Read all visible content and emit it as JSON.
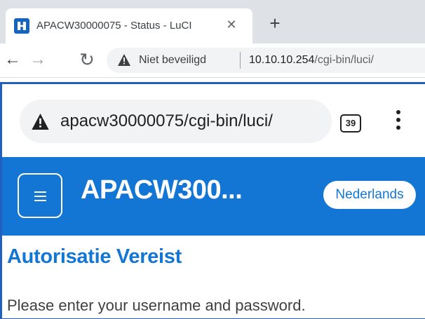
{
  "desktop_browser": {
    "tab": {
      "title": "APACW30000075 - Status - LuCI",
      "close_glyph": "✕",
      "favicon": "luci-favicon-icon"
    },
    "new_tab_glyph": "+",
    "toolbar": {
      "back_glyph": "←",
      "forward_glyph": "→",
      "reload_glyph": "↻",
      "security_label": "Niet beveiligd",
      "url_host": "10.10.10.254",
      "url_path": "/cgi-bin/luci/"
    }
  },
  "mobile_browser": {
    "url": "apacw30000075/cgi-bin/luci/",
    "tab_count": "39",
    "menu_icon": "kebab-menu-icon"
  },
  "page": {
    "hostname": "APACW300...",
    "language_button": "Nederlands",
    "heading": "Autorisatie Vereist",
    "message": "Please enter your username and password."
  },
  "colors": {
    "brand_blue": "#1476d4",
    "frame_blue": "#2060c0",
    "tabstrip_gray": "#dee1e6",
    "omnibox_gray": "#f1f3f4"
  }
}
